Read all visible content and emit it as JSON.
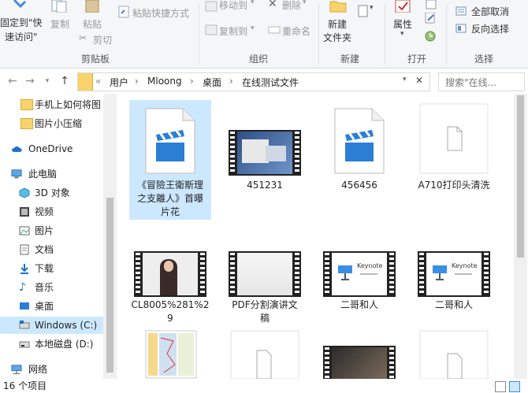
{
  "ribbon": {
    "pin_quick_access_line1": "固定到\"快",
    "pin_quick_access_line2": "速访问\"",
    "copy": "复制",
    "paste": "粘贴",
    "paste_shortcut": "粘贴快捷方式",
    "cut": "剪切",
    "clipboard_group": "剪贴板",
    "move_to": "移动到",
    "copy_to": "复制到",
    "delete": "删除",
    "rename": "重命名",
    "organize_group": "组织",
    "new_folder_line1": "新建",
    "new_folder_line2": "文件夹",
    "new_group": "新建",
    "properties": "属性",
    "open_group": "打开",
    "select_none": "全部取消",
    "invert_selection": "反向选择",
    "select_group": "选择"
  },
  "address": {
    "chevron": "«",
    "crumbs": [
      "用户",
      "Mloong",
      "桌面",
      "在线测试文件"
    ],
    "search_placeholder": "搜索\"在线..."
  },
  "nav": {
    "items": [
      {
        "label": "手机上如何将图",
        "icon": "folder-icon"
      },
      {
        "label": "图片小压缩",
        "icon": "folder-icon"
      },
      {
        "label": "OneDrive",
        "icon": "cloud-icon"
      },
      {
        "label": "此电脑",
        "icon": "computer-icon"
      },
      {
        "label": "3D 对象",
        "icon": "3d-objects-icon"
      },
      {
        "label": "视频",
        "icon": "video-folder-icon"
      },
      {
        "label": "图片",
        "icon": "pictures-folder-icon"
      },
      {
        "label": "文档",
        "icon": "documents-folder-icon"
      },
      {
        "label": "下载",
        "icon": "downloads-folder-icon"
      },
      {
        "label": "音乐",
        "icon": "music-folder-icon"
      },
      {
        "label": "桌面",
        "icon": "desktop-folder-icon"
      },
      {
        "label": "Windows (C:)",
        "icon": "drive-c-icon"
      },
      {
        "label": "本地磁盘 (D:)",
        "icon": "drive-d-icon"
      },
      {
        "label": "网络",
        "icon": "network-icon"
      }
    ]
  },
  "files": [
    {
      "name_l1": "《冒險王衛斯理",
      "name_l2": "之支離人》首曝",
      "name_l3": "片花",
      "type": "video-file"
    },
    {
      "name_l1": "451231",
      "name_l2": "",
      "name_l3": "",
      "type": "video-thumb-screen"
    },
    {
      "name_l1": "456456",
      "name_l2": "",
      "name_l3": "",
      "type": "video-file"
    },
    {
      "name_l1": "A710打印头清洗",
      "name_l2": "",
      "name_l3": "",
      "type": "blank-file"
    },
    {
      "name_l1": "CL8005%281%2",
      "name_l2": "9",
      "name_l3": "",
      "type": "video-thumb-person"
    },
    {
      "name_l1": "PDF分割演讲文",
      "name_l2": "稿",
      "name_l3": "",
      "type": "video-thumb-blank"
    },
    {
      "name_l1": "二哥和人",
      "name_l2": "",
      "name_l3": "",
      "type": "video-thumb-keynote"
    },
    {
      "name_l1": "二哥和人",
      "name_l2": "",
      "name_l3": "",
      "type": "video-thumb-keynote"
    },
    {
      "name_l1": "",
      "name_l2": "",
      "name_l3": "",
      "type": "image-map"
    },
    {
      "name_l1": "",
      "name_l2": "",
      "name_l3": "",
      "type": "blank-file"
    },
    {
      "name_l1": "",
      "name_l2": "",
      "name_l3": "",
      "type": "video-thumb-dark"
    },
    {
      "name_l1": "",
      "name_l2": "",
      "name_l3": "",
      "type": "blank-file"
    }
  ],
  "keynote_title": "Keynote",
  "status": {
    "count": "16 个项目"
  },
  "colors": {
    "accent": "#0078d7",
    "selection": "#cce8ff",
    "folder": "#f8d26a",
    "clapper_blue": "#2a7fd4"
  }
}
